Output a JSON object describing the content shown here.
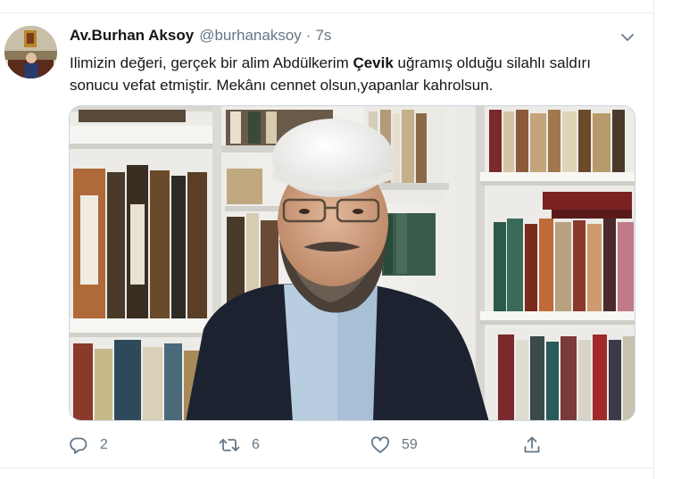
{
  "tweet": {
    "display_name": "Av.Burhan Aksoy",
    "handle": "@burhanaksoy",
    "separator": "·",
    "time": "7s",
    "text_part1": "Ilimizin değeri, gerçek bir alim Abdülkerim ",
    "text_bold": "Çevik",
    "text_part2": " uğramış olduğu silahlı saldırı sonucu vefat etmiştir. Mekânı cennet olsun,yapanlar kahrolsun."
  },
  "actions": {
    "reply_count": "2",
    "retweet_count": "6",
    "like_count": "59"
  },
  "icons": {
    "reply": "reply-icon",
    "retweet": "retweet-icon",
    "like": "heart-icon",
    "share": "share-icon",
    "caret": "chevron-down-icon"
  },
  "colors": {
    "secondary_text": "#657786",
    "border": "#e6ecf0"
  }
}
